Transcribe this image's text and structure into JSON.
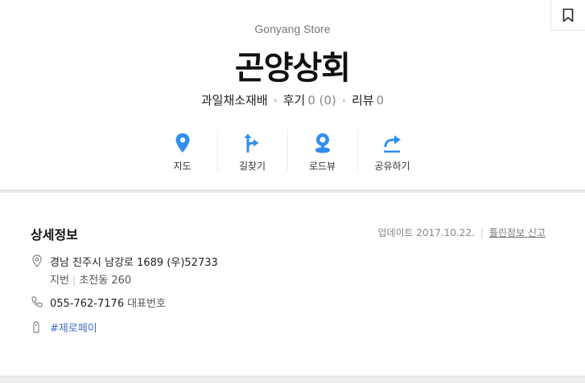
{
  "store": {
    "english_name": "Gonyang Store",
    "name": "곤양상회",
    "category": "과일채소재배",
    "reviews_label": "후기",
    "reviews_value": "0 (0)",
    "ratings_label": "리뷰",
    "ratings_value": "0"
  },
  "actions": [
    {
      "label": "지도",
      "icon": "map-pin-icon"
    },
    {
      "label": "길찾기",
      "icon": "directions-icon"
    },
    {
      "label": "로드뷰",
      "icon": "roadview-icon"
    },
    {
      "label": "공유하기",
      "icon": "share-icon"
    }
  ],
  "detail": {
    "title": "상세정보",
    "updated": "업데이트 2017.10.22.",
    "report_link": "틀린정보 신고",
    "address": "경남 진주시 남강로 1689 (우)52733",
    "jibun_label": "지번",
    "jibun_value": "초전동 260",
    "phone": "055-762-7176",
    "phone_label": "대표번호",
    "tag": "#제로페이"
  },
  "colors": {
    "accent": "#2e8ff0",
    "link": "#3d6fc5"
  }
}
